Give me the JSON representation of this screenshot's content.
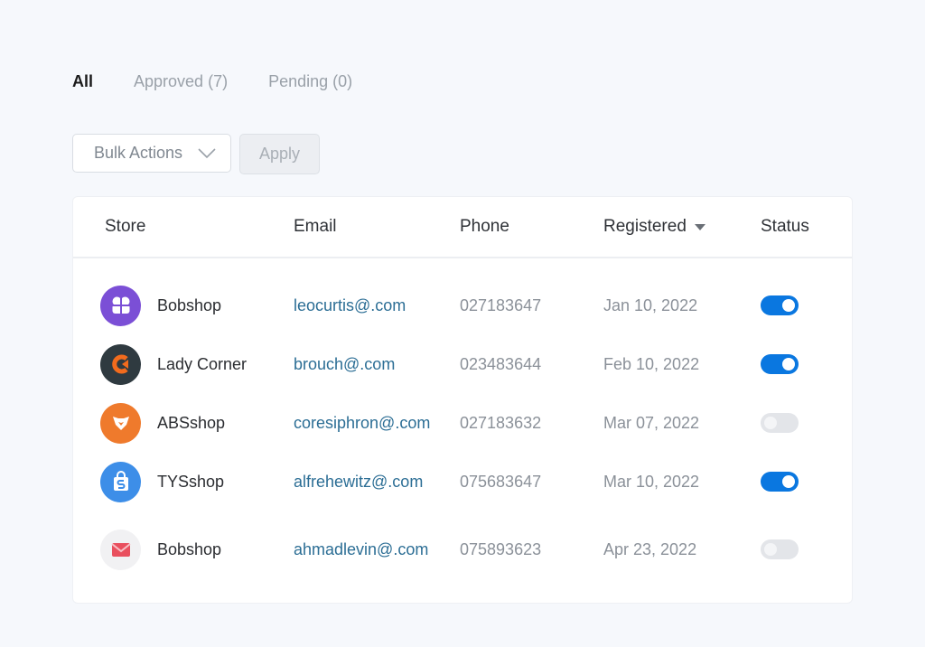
{
  "tabs": [
    {
      "label": "All",
      "active": true
    },
    {
      "label": "Approved (7)",
      "active": false
    },
    {
      "label": "Pending (0)",
      "active": false
    }
  ],
  "toolbar": {
    "bulk_actions_label": "Bulk Actions",
    "apply_label": "Apply"
  },
  "table": {
    "columns": {
      "store": "Store",
      "email": "Email",
      "phone": "Phone",
      "registered": "Registered",
      "status": "Status"
    },
    "sort": {
      "column": "Registered",
      "direction": "desc"
    },
    "rows": [
      {
        "store": "Bobshop",
        "email": "leocurtis@.com",
        "phone": "027183647",
        "registered": "Jan 10, 2022",
        "status_on": true,
        "logo_icon": "bobshop-purple-logo-icon",
        "logo_color": "#7b4fd6"
      },
      {
        "store": "Lady Corner",
        "email": "brouch@.com",
        "phone": "023483644",
        "registered": "Feb 10, 2022",
        "status_on": true,
        "logo_icon": "lady-corner-logo-icon",
        "logo_color": "#2f3a40"
      },
      {
        "store": "ABSshop",
        "email": "coresiphron@.com",
        "phone": "027183632",
        "registered": "Mar 07, 2022",
        "status_on": false,
        "logo_icon": "absshop-fox-logo-icon",
        "logo_color": "#ef7a2c"
      },
      {
        "store": "TYSshop",
        "email": "alfrehewitz@.com",
        "phone": "075683647",
        "registered": "Mar 10, 2022",
        "status_on": true,
        "logo_icon": "tysshop-bag-logo-icon",
        "logo_color": "#3d8ee8"
      },
      {
        "store": "Bobshop",
        "email": "ahmadlevin@.com",
        "phone": "075893623",
        "registered": "Apr 23, 2022",
        "status_on": false,
        "logo_icon": "bobshop-envelope-logo-icon",
        "logo_color": "#e94f5e"
      }
    ]
  },
  "colors": {
    "accent": "#0a77e0",
    "link": "#2c6e95",
    "toggle_off": "#e3e5e9",
    "background": "#f6f8fc"
  }
}
